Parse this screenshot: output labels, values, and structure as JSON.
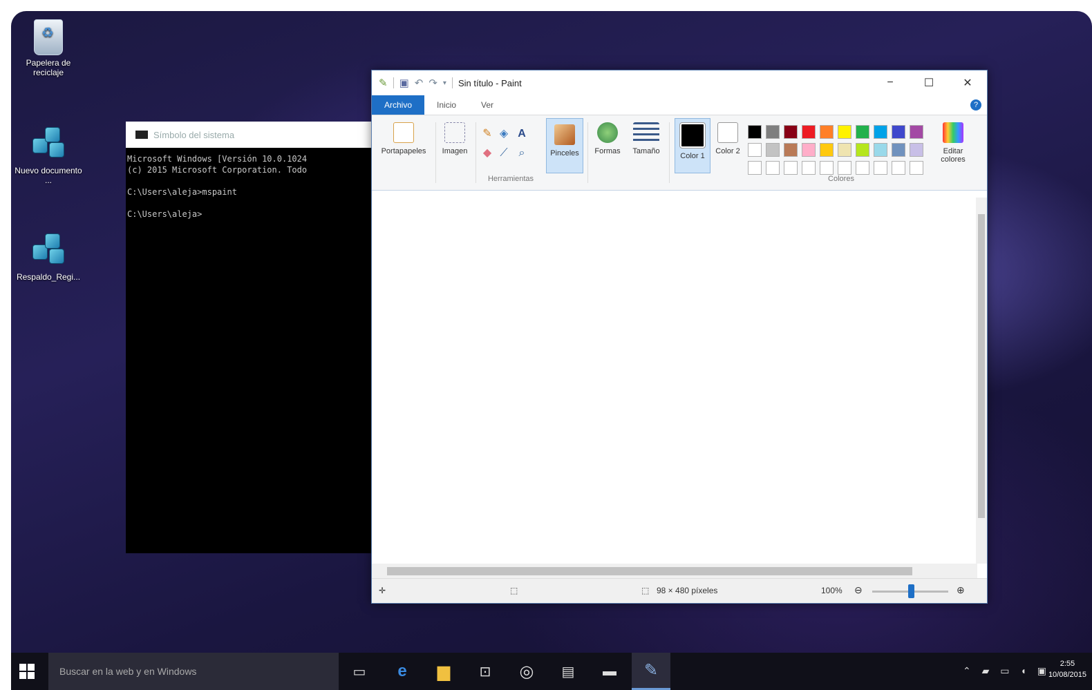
{
  "desktop": {
    "icons": [
      {
        "label": "Papelera de reciclaje"
      },
      {
        "label": "Nuevo documento ..."
      },
      {
        "label": "Respaldo_Regi..."
      }
    ]
  },
  "cmd": {
    "title": "Símbolo del sistema",
    "lines": "Microsoft Windows [Versión 10.0.1024\n(c) 2015 Microsoft Corporation. Todo\n\nC:\\Users\\aleja>mspaint\n\nC:\\Users\\aleja>"
  },
  "paint": {
    "title": "Sin título - Paint",
    "tabs": {
      "file": "Archivo",
      "home": "Inicio",
      "view": "Ver"
    },
    "ribbon": {
      "clipboard": "Portapapeles",
      "image": "Imagen",
      "tools_group": "Herramientas",
      "brushes": "Pinceles",
      "shapes": "Formas",
      "size": "Tamaño",
      "color1": "Color 1",
      "color2": "Color 2",
      "colors_group": "Colores",
      "edit_colors": "Editar colores"
    },
    "palette_row1": [
      "#000000",
      "#7f7f7f",
      "#880015",
      "#ed1c24",
      "#ff7f27",
      "#fff200",
      "#22b14c",
      "#00a2e8",
      "#3f48cc",
      "#a349a4"
    ],
    "palette_row2": [
      "#ffffff",
      "#c3c3c3",
      "#b97a57",
      "#ffaec9",
      "#ffc90e",
      "#efe4b0",
      "#b5e61d",
      "#99d9ea",
      "#7092be",
      "#c8bfe7"
    ],
    "status": {
      "size": "98 × 480 píxeles",
      "zoom": "100%"
    }
  },
  "taskbar": {
    "search_placeholder": "Buscar en la web y en Windows",
    "time": "2:55",
    "date": "10/08/2015"
  }
}
